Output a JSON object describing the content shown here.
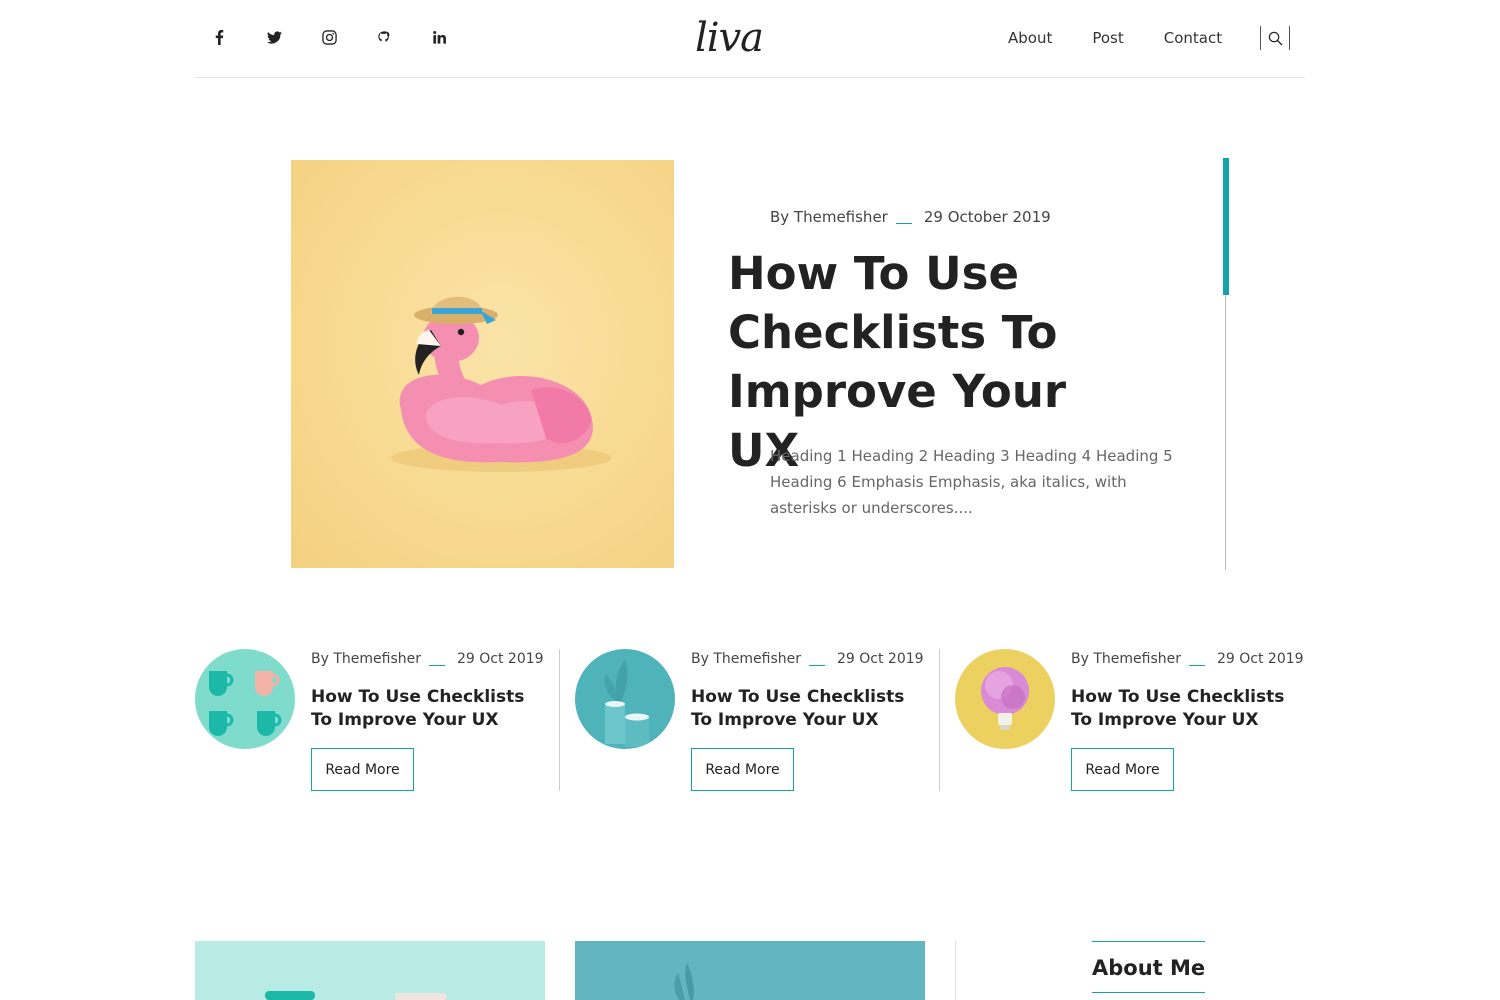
{
  "header": {
    "logo": "liva",
    "social": [
      "facebook-icon",
      "twitter-icon",
      "instagram-icon",
      "github-icon",
      "linkedin-icon"
    ],
    "nav": [
      {
        "label": "About"
      },
      {
        "label": "Post"
      },
      {
        "label": "Contact"
      }
    ],
    "search_icon": "search-icon"
  },
  "featured": {
    "author": "By Themefisher",
    "date": "29 October 2019",
    "title": "How To Use Checklists To Improve Your UX",
    "excerpt": "Heading 1 Heading 2 Heading 3 Heading 4 Heading 5 Heading 6 Emphasis Emphasis, aka italics, with asterisks or underscores...."
  },
  "posts": [
    {
      "author": "By Themefisher",
      "date": "29 Oct 2019",
      "title": "How To Use Checklists To Improve Your UX",
      "button": "Read More"
    },
    {
      "author": "By Themefisher",
      "date": "29 Oct 2019",
      "title": "How To Use Checklists To Improve Your UX",
      "button": "Read More"
    },
    {
      "author": "By Themefisher",
      "date": "29 Oct 2019",
      "title": "How To Use Checklists To Improve Your UX",
      "button": "Read More"
    }
  ],
  "sidebar": {
    "about_title": "About Me"
  },
  "colors": {
    "accent": "#14a3a9",
    "text": "#222222",
    "muted": "#666666"
  }
}
